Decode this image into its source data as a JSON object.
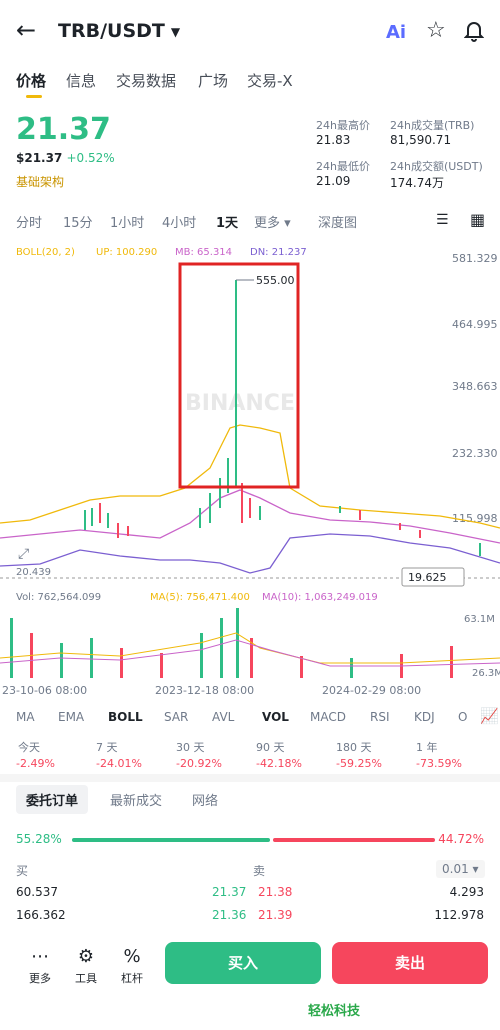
{
  "header": {
    "back_icon": "arrow-left-icon",
    "pair": "TRB/USDT",
    "ai": "Ai"
  },
  "tabs": [
    "价格",
    "信息",
    "交易数据",
    "广场",
    "交易-X"
  ],
  "price": {
    "last": "21.37",
    "usd": "$21.37",
    "change": "+0.52%",
    "tag": "基础架构"
  },
  "stats": {
    "high_label": "24h最高价",
    "high": "21.83",
    "low_label": "24h最低价",
    "low": "21.09",
    "vol_trb_label": "24h成交量(TRB)",
    "vol_trb": "81,590.71",
    "vol_usdt_label": "24h成交额(USDT)",
    "vol_usdt": "174.74万"
  },
  "timeframes": [
    "分时",
    "15分",
    "1小时",
    "4小时",
    "1天",
    "更多 ▾",
    "深度图"
  ],
  "boll_legend": {
    "boll": "BOLL(20, 2)",
    "up": "UP: 100.290",
    "mb": "MB: 65.314",
    "dn": "DN: 21.237"
  },
  "chart_labels": {
    "y_ticks": [
      "581.329",
      "464.995",
      "348.663",
      "232.330",
      "115.998"
    ],
    "peak": "555.00",
    "low_mark": "20.439",
    "current": "19.625",
    "vol_legend": "Vol: 762,564.099",
    "ma5": "MA(5): 756,471.400",
    "ma10": "MA(10): 1,063,249.019",
    "vol_ticks": [
      "63.1M",
      "26.3M"
    ],
    "dates": [
      "23-10-06 08:00",
      "2023-12-18 08:00",
      "2024-02-29 08:00"
    ],
    "watermark": "BINANCE"
  },
  "indicators": [
    "MA",
    "EMA",
    "BOLL",
    "SAR",
    "AVL",
    "VOL",
    "MACD",
    "RSI",
    "KDJ",
    "O"
  ],
  "performance": [
    {
      "label": "今天",
      "value": "-2.49%"
    },
    {
      "label": "7 天",
      "value": "-24.01%"
    },
    {
      "label": "30 天",
      "value": "-20.92%"
    },
    {
      "label": "90 天",
      "value": "-42.18%"
    },
    {
      "label": "180 天",
      "value": "-59.25%"
    },
    {
      "label": "1 年",
      "value": "-73.59%"
    }
  ],
  "orderbook": {
    "tabs": [
      "委托订单",
      "最新成交",
      "网络"
    ],
    "buy_ratio": "55.28%",
    "sell_ratio": "44.72%",
    "buy_label": "买",
    "sell_label": "卖",
    "step": "0.01 ▾",
    "rows": [
      {
        "bid_qty": "60.537",
        "bid": "21.37",
        "ask": "21.38",
        "ask_qty": "4.293"
      },
      {
        "bid_qty": "166.362",
        "bid": "21.36",
        "ask": "21.39",
        "ask_qty": "112.978"
      }
    ]
  },
  "bottom": {
    "more": "更多",
    "tools": "工具",
    "leverage": "杠杆",
    "buy": "买入",
    "sell": "卖出"
  },
  "watermark_text": "轻松科技"
}
